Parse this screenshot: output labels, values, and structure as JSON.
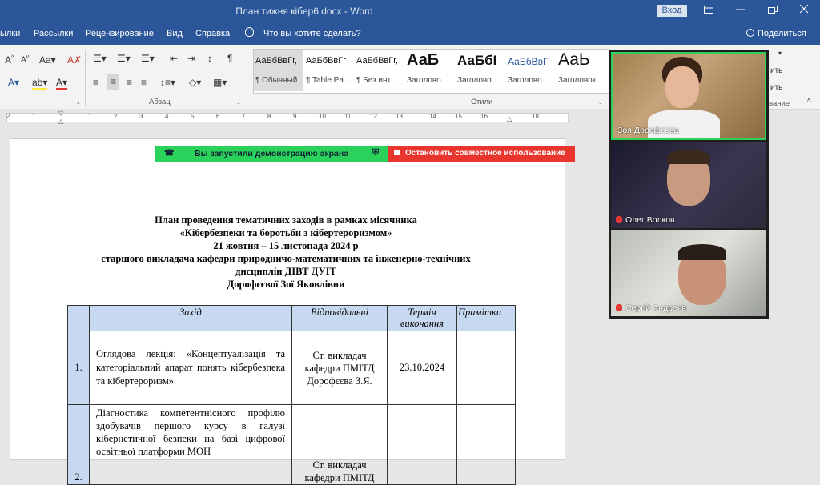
{
  "window": {
    "title": "План тижня кібер6.docx  -  Word",
    "sign_in": "Вход",
    "ribbon_icon": "ribbon-display-icon",
    "minimize_icon": "minimize-icon",
    "maximize_icon": "restore-icon",
    "close_icon": "close-icon"
  },
  "menu": {
    "items": [
      "ылки",
      "Рассылки",
      "Рецензирование",
      "Вид",
      "Справка"
    ],
    "tell_me": "Что вы хотите сделать?",
    "share": "Поделиться"
  },
  "ribbon": {
    "paragraph_label": "Абзац",
    "styles_label": "Стили",
    "right_fragments": [
      "ить",
      "ить",
      "вание"
    ],
    "styles": [
      {
        "sample": "АаБбВвГг,",
        "name": "¶ Обычный"
      },
      {
        "sample": "АаБбВвГг",
        "name": "¶ Table Pa..."
      },
      {
        "sample": "АаБбВвГг,",
        "name": "¶ Без инт..."
      },
      {
        "sample": "АаБ",
        "name": "Заголово..."
      },
      {
        "sample": "АаБбI",
        "name": "Заголово..."
      },
      {
        "sample": "АаБбВвГ",
        "name": "Заголово..."
      },
      {
        "sample": "АаЬ",
        "name": "Заголовок"
      }
    ]
  },
  "ruler": {
    "ticks": [
      "2",
      "1",
      "1",
      "2",
      "3",
      "4",
      "5",
      "6",
      "7",
      "8",
      "9",
      "10",
      "11",
      "12",
      "13",
      "14",
      "15",
      "16",
      "18"
    ]
  },
  "screen_share": {
    "status": "Вы запустили демонстрацию экрана",
    "stop": "Остановить совместное использование"
  },
  "document": {
    "heading_lines": [
      "План проведення тематичних заходів в рамках місячника",
      "«Кібербезпеки та боротьби з кібертероризмом»",
      "21 жовтня – 15 листопада 2024 р",
      "старшого викладача кафедри природничо-математичних та інженерно-технічних",
      "дисциплін ДІВТ ДУІТ",
      "Дорофєєвої Зої Яковлівни"
    ],
    "table": {
      "headers": [
        "Захід",
        "Відповідальні",
        "Термін виконання",
        "Примітки"
      ],
      "rows": [
        {
          "num": "1.",
          "event": "Оглядова лекція: «Концептуалізація та категоріальний апарат понять кібербезпека та кібертероризм»",
          "responsible": "Ст. викладач кафедри ПМІТД Дорофєєва З.Я.",
          "date": "23.10.2024",
          "notes": ""
        },
        {
          "num": "2.",
          "event": "Діагностика компетентнісного профілю здобувачів першого курсу в галузі кібернетичної безпеки на базі цифрової освітньої платформи МОН",
          "responsible": "Ст. викладач кафедри ПМІТД",
          "date": "",
          "notes": ""
        }
      ]
    }
  },
  "participants": [
    {
      "name": "Зоя Дорофєєва",
      "muted": false
    },
    {
      "name": "Олег Волков",
      "muted": true
    },
    {
      "name": "Сергій Андреєв",
      "muted": true
    }
  ]
}
